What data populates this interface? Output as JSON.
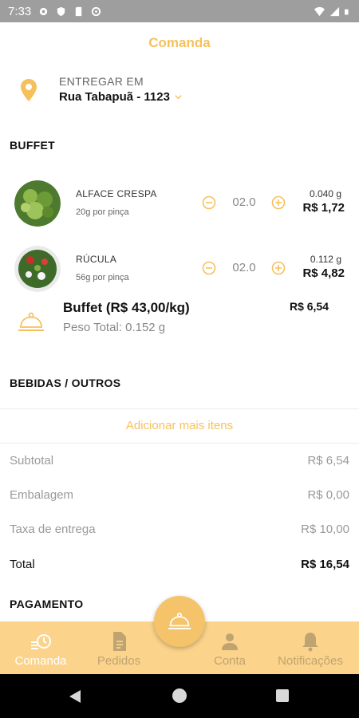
{
  "status_bar": {
    "time": "7:33"
  },
  "header": {
    "title": "Comanda"
  },
  "delivery": {
    "label": "ENTREGAR EM",
    "address": "Rua Tabapuã - 1123"
  },
  "buffet": {
    "section_title": "BUFFET",
    "items": [
      {
        "name": "ALFACE CRESPA",
        "portion": "20g por pinça",
        "quantity": "02.0",
        "weight": "0.040 g",
        "price": "R$ 1,72"
      },
      {
        "name": "RÚCULA",
        "portion": "56g por pinça",
        "quantity": "02.0",
        "weight": "0.112 g",
        "price": "R$ 4,82"
      }
    ],
    "summary": {
      "name": "Buffet (R$ 43,00/kg)",
      "total_weight": "Peso Total: 0.152 g",
      "total": "R$ 6,54"
    }
  },
  "drinks": {
    "section_title": "BEBIDAS / OUTROS"
  },
  "add_more_label": "Adicionar mais itens",
  "totals": {
    "subtotal_label": "Subtotal",
    "subtotal": "R$ 6,54",
    "packaging_label": "Embalagem",
    "packaging": "R$ 0,00",
    "delivery_fee_label": "Taxa de entrega",
    "delivery_fee": "R$ 10,00",
    "total_label": "Total",
    "total": "R$ 16,54"
  },
  "payment": {
    "section_title": "PAGAMENTO"
  },
  "tabs": [
    {
      "label": "Comanda",
      "icon": "order-clock-icon",
      "active": true
    },
    {
      "label": "Pedidos",
      "icon": "document-icon",
      "active": false
    },
    {
      "label": "Conta",
      "icon": "person-icon",
      "active": false
    },
    {
      "label": "Notificações",
      "icon": "bell-icon",
      "active": false
    }
  ],
  "colors": {
    "accent": "#f6c15c",
    "tabbar": "#fbd38a",
    "tab_active": "#ffffff",
    "tab_inactive": "#bfa472",
    "status_bar": "#9e9e9e"
  }
}
